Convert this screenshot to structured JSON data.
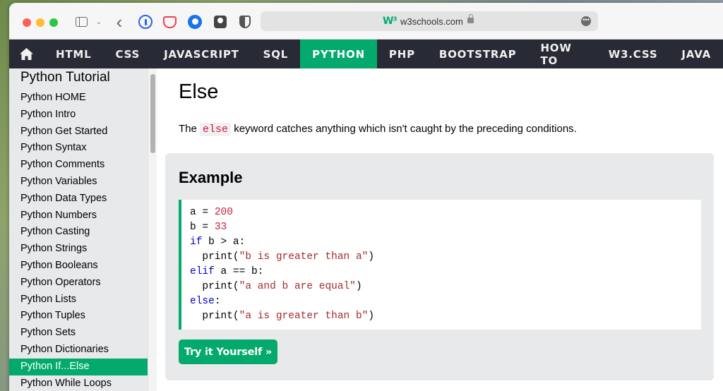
{
  "browser": {
    "url": "w3schools.com",
    "site_logo": "W³",
    "more_label": "•••"
  },
  "nav": {
    "items": [
      "HTML",
      "CSS",
      "JAVASCRIPT",
      "SQL",
      "PYTHON",
      "PHP",
      "BOOTSTRAP",
      "HOW TO",
      "W3.CSS",
      "JAVA"
    ],
    "active": "PYTHON"
  },
  "sidebar": {
    "heading": "Python Tutorial",
    "items": [
      "Python HOME",
      "Python Intro",
      "Python Get Started",
      "Python Syntax",
      "Python Comments",
      "Python Variables",
      "Python Data Types",
      "Python Numbers",
      "Python Casting",
      "Python Strings",
      "Python Booleans",
      "Python Operators",
      "Python Lists",
      "Python Tuples",
      "Python Sets",
      "Python Dictionaries",
      "Python If...Else",
      "Python While Loops"
    ],
    "active": "Python If...Else"
  },
  "main": {
    "title": "Else",
    "intro_before": "The ",
    "intro_keyword": "else",
    "intro_after": " keyword catches anything which isn't caught by the preceding conditions.",
    "example_heading": "Example",
    "code": {
      "l1_a": "a = ",
      "l1_num": "200",
      "l2_a": "b = ",
      "l2_num": "33",
      "l3_kw": "if",
      "l3_rest": " b > a:",
      "l4_fn": "  print(",
      "l4_str": "\"b is greater than a\"",
      "l4_end": ")",
      "l5_kw": "elif",
      "l5_rest": " a == b:",
      "l6_fn": "  print(",
      "l6_str": "\"a and b are equal\"",
      "l6_end": ")",
      "l7_kw": "else",
      "l7_rest": ":",
      "l8_fn": "  print(",
      "l8_str": "\"a is greater than b\"",
      "l8_end": ")"
    },
    "try_button": "Try it Yourself »"
  },
  "colors": {
    "accent": "#04aa6d",
    "nav_bg": "#282a35",
    "sidebar_bg": "#e7e9eb",
    "keyword_red": "#dc143c"
  },
  "icons": [
    "home-icon",
    "sidebar-toggle-icon",
    "chevron-down-icon",
    "back-arrow-icon",
    "lock-icon",
    "more-icon"
  ]
}
